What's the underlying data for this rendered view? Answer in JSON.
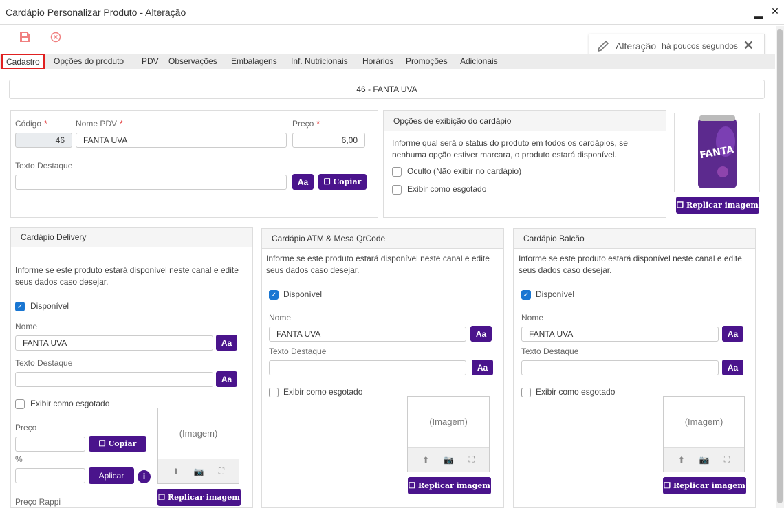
{
  "window": {
    "title": "Cardápio Personalizar Produto - Alteração",
    "minimize": "▁",
    "close": "✕"
  },
  "toast": {
    "label": "Alteração",
    "time": "há poucos segundos"
  },
  "tabs": [
    {
      "label": "Cadastro"
    },
    {
      "label": "Opções do produto"
    },
    {
      "label": "PDV"
    },
    {
      "label": "Observações"
    },
    {
      "label": "Embalagens"
    },
    {
      "label": "Inf. Nutricionais"
    },
    {
      "label": "Horários"
    },
    {
      "label": "Promoções"
    },
    {
      "label": "Adicionais"
    }
  ],
  "product_header": "46 - FANTA UVA",
  "basic": {
    "codigo_label": "Código",
    "codigo_value": "46",
    "nome_label": "Nome PDV",
    "nome_value": "FANTA UVA",
    "preco_label": "Preço",
    "preco_value": "6,00",
    "destaque_label": "Texto Destaque",
    "aa": "Aa",
    "copiar": "Copiar"
  },
  "display": {
    "title": "Opções de exibição do cardápio",
    "info": "Informe qual será o status do produto em todos os cardápios, se nenhuma opção estiver marcara, o produto estará disponível.",
    "oculto": "Oculto (Não exibir no cardápio)",
    "esgotado": "Exibir como esgotado"
  },
  "image": {
    "replicar": "Replicar imagem",
    "brand": "FANTA"
  },
  "delivery": {
    "title": "Cardápio Delivery",
    "info": "Informe se este produto estará disponível neste canal e edite seus dados caso desejar.",
    "disponivel": "Disponível",
    "nome_label": "Nome",
    "nome_value": "FANTA UVA",
    "destaque_label": "Texto Destaque",
    "esgotado": "Exibir como esgotado",
    "preco_label": "Preço",
    "pct_label": "%",
    "copiar": "Copiar",
    "aplicar": "Aplicar",
    "rappi_label": "Preço Rappi",
    "imagem": "(Imagem)",
    "replicar": "Replicar imagem",
    "aa": "Aa"
  },
  "atm": {
    "title": "Cardápio ATM & Mesa QrCode",
    "info": "Informe se este produto estará disponível neste canal e edite seus dados caso desejar.",
    "disponivel": "Disponível",
    "nome_label": "Nome",
    "nome_value": "FANTA UVA",
    "destaque_label": "Texto Destaque",
    "esgotado": "Exibir como esgotado",
    "imagem": "(Imagem)",
    "replicar": "Replicar imagem",
    "aa": "Aa"
  },
  "balcao": {
    "title": "Cardápio Balcão",
    "info": "Informe se este produto estará disponível neste canal e edite seus dados caso desejar.",
    "disponivel": "Disponível",
    "nome_label": "Nome",
    "nome_value": "FANTA UVA",
    "destaque_label": "Texto Destaque",
    "esgotado": "Exibir como esgotado",
    "imagem": "(Imagem)",
    "replicar": "Replicar imagem",
    "aa": "Aa"
  },
  "colors": {
    "accent": "#4a148c",
    "check": "#1976d2",
    "danger": "#e02020"
  }
}
